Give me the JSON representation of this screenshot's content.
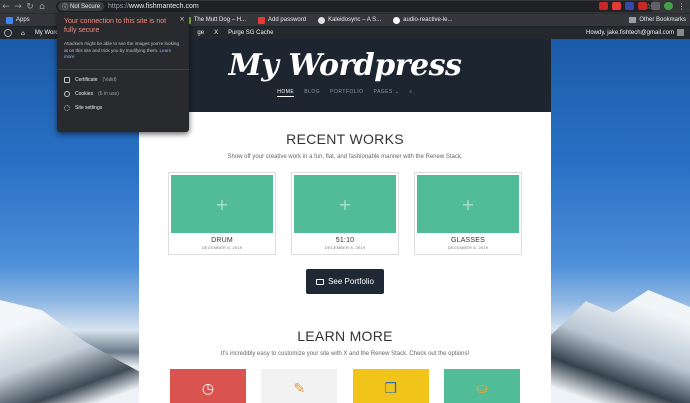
{
  "browser": {
    "nav": [
      "←",
      "→",
      "↻",
      "⌂"
    ],
    "security_chip": "Not Secure",
    "url_prefix": "https://",
    "url_host": "www.fishmantech.com",
    "star": "☆"
  },
  "bookmarks": {
    "apps": "Apps",
    "items": [
      "The Mutt Dog – H...",
      "Add password",
      "Kaleidosync – A S...",
      "audio-reactive-le..."
    ],
    "other": "Other Bookmarks"
  },
  "adminbar": {
    "site": "My Wordpress",
    "customize_suffix": "ge",
    "close_x": "X",
    "purge": "Purge SG Cache",
    "howdy": "Howdy, jake.fishtech@gmail.com"
  },
  "popup": {
    "title": "Your connection to this site is not fully secure",
    "description": "Attackers might be able to see the images you're looking at on this site and trick you by modifying them.",
    "learn_more": "Learn more",
    "close": "×",
    "rows": [
      {
        "label": "Certificate",
        "sub": "(Valid)"
      },
      {
        "label": "Cookies",
        "sub": "(6 in use)"
      },
      {
        "label": "Site settings",
        "sub": ""
      }
    ]
  },
  "site": {
    "title": "My Wordpress",
    "nav": [
      "HOME",
      "BLOG",
      "PORTFOLIO",
      "PAGES ⌄",
      "⌕"
    ]
  },
  "recent_works": {
    "title": "RECENT WORKS",
    "subtitle": "Show off your creative work in a fun, flat, and fashionable manner with the Renew Stack.",
    "cards": [
      {
        "name": "DRUM",
        "date": "DECEMBER 8, 2019"
      },
      {
        "name": "51:10",
        "date": "DECEMBER 8, 2019"
      },
      {
        "name": "GLASSES",
        "date": "DECEMBER 8, 2019"
      }
    ],
    "button": "See Portfolio"
  },
  "learn_more": {
    "title": "LEARN MORE",
    "subtitle": "It's incredibly easy to customize your site with X and the Renew Stack. Check out the options!",
    "tiles": [
      {
        "icon": "clock-icon",
        "glyph": "◷",
        "color": "#d9534f"
      },
      {
        "icon": "pencil-ruler-icon",
        "glyph": "✎",
        "color": "#f2f2f2"
      },
      {
        "icon": "book-icon",
        "glyph": "❒",
        "color": "#f0c419"
      },
      {
        "icon": "jar-icon",
        "glyph": "⛀",
        "color": "#52bb98"
      }
    ]
  },
  "colors": {
    "accent_green": "#52bb98",
    "header_dark": "#1c2530",
    "warning_red": "#f28b82"
  }
}
